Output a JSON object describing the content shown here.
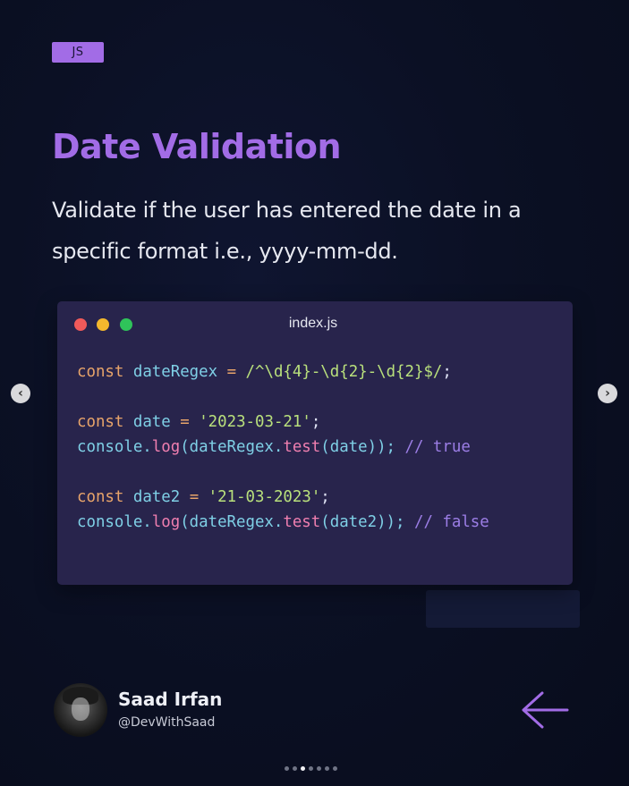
{
  "badge": "JS",
  "title": "Date Validation",
  "description": "Validate if the user has entered the date in a specific format i.e., yyyy-mm-dd.",
  "editor": {
    "filename": "index.js",
    "window_controls": [
      "red-dot",
      "yellow-dot",
      "green-dot"
    ],
    "code": {
      "l1_kw": "const",
      "l1_id": "dateRegex",
      "l1_op": "=",
      "l1_regex": "/^\\d{4}-\\d{2}-\\d{2}$/",
      "l1_end": ";",
      "l2_kw": "const",
      "l2_id": "date",
      "l2_op": "=",
      "l2_str": "'2023-03-21'",
      "l2_end": ";",
      "l3_obj": "console.",
      "l3_fn": "log",
      "l3_a": "(dateRegex.",
      "l3_fn2": "test",
      "l3_b": "(date));",
      "l3_comment": "// true",
      "l4_kw": "const",
      "l4_id": "date2",
      "l4_op": "=",
      "l4_str": "'21-03-2023'",
      "l4_end": ";",
      "l5_obj": "console.",
      "l5_fn": "log",
      "l5_a": "(dateRegex.",
      "l5_fn2": "test",
      "l5_b": "(date2));",
      "l5_comment": "// false"
    }
  },
  "nav": {
    "prev_icon": "chevron-left-icon",
    "next_icon": "chevron-right-icon"
  },
  "author": {
    "name": "Saad Irfan",
    "handle": "@DevWithSaad"
  },
  "pager": {
    "total": 7,
    "active_index": 2
  },
  "colors": {
    "accent": "#a26ce6",
    "background": "#0b1024",
    "editor_bg": "#28244c"
  }
}
